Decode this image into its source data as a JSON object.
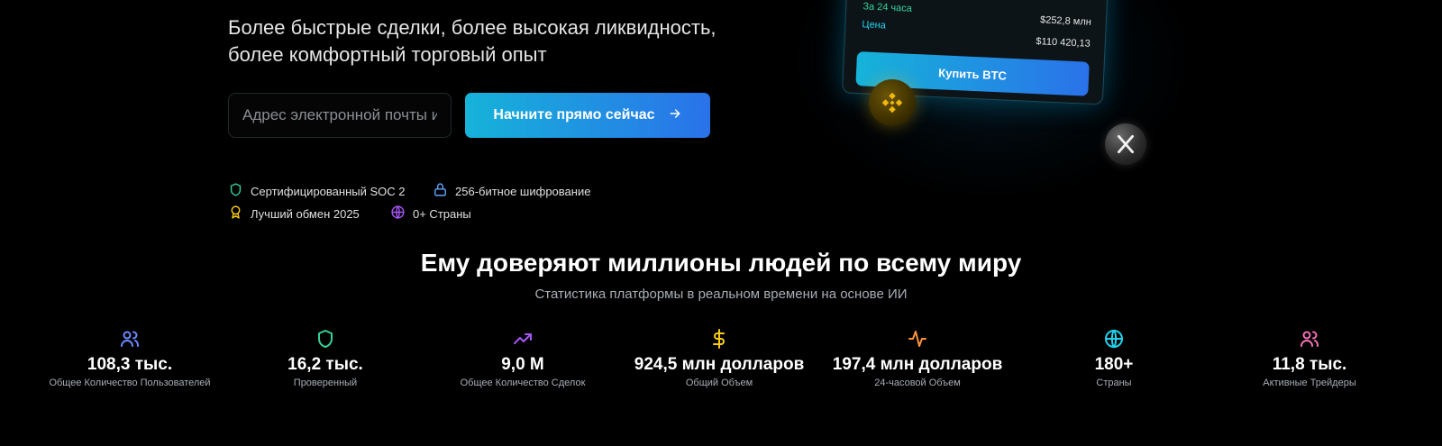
{
  "hero": {
    "subtitle": "Более быстрые сделки, более высокая ликвидность, более комфортный торговый опыт",
    "email_placeholder": "Адрес электронной почты или номер телефона",
    "cta_label": "Начните прямо сейчас",
    "cta_icon": "arrow-right-icon",
    "accent_gradient": [
      "#16b3d9",
      "#2a72ea"
    ]
  },
  "badges": [
    {
      "label": "Сертифицированный SOC 2",
      "icon": "shield-icon",
      "color": "#34d399"
    },
    {
      "label": "256-битное шифрование",
      "icon": "lock-icon",
      "color": "#60a5fa"
    },
    {
      "label": "Лучший обмен 2025",
      "icon": "award-icon",
      "color": "#facc15"
    },
    {
      "label": "0+ Страны",
      "icon": "globe-icon",
      "color": "#a855f7"
    }
  ],
  "card": {
    "volume_label": "За 24 часа",
    "volume_value": "$252,8 млн",
    "price_label": "Цена",
    "price_value": "$110 420,13",
    "buy_label": "Купить BTC"
  },
  "stats_section": {
    "title": "Ему доверяют миллионы людей по всему миру",
    "subtitle": "Статистика платформы в реальном времени на основе ИИ",
    "items": [
      {
        "value": "108,3 тыс.",
        "label": "Общее Количество Пользователей",
        "icon": "users-icon",
        "color": "#6b8cff"
      },
      {
        "value": "16,2 тыс.",
        "label": "Проверенный",
        "icon": "shield-icon",
        "color": "#34d399"
      },
      {
        "value": "9,0 М",
        "label": "Общее Количество Сделок",
        "icon": "trending-up-icon",
        "color": "#a855f7"
      },
      {
        "value": "924,5 млн долларов",
        "label": "Общий Объем",
        "icon": "dollar-icon",
        "color": "#facc15"
      },
      {
        "value": "197,4 млн долларов",
        "label": "24-часовой Объем",
        "icon": "activity-icon",
        "color": "#fb923c"
      },
      {
        "value": "180+",
        "label": "Страны",
        "icon": "globe-icon",
        "color": "#22d3ee"
      },
      {
        "value": "11,8 тыс.",
        "label": "Активные Трейдеры",
        "icon": "users-icon",
        "color": "#f472b6"
      }
    ]
  }
}
